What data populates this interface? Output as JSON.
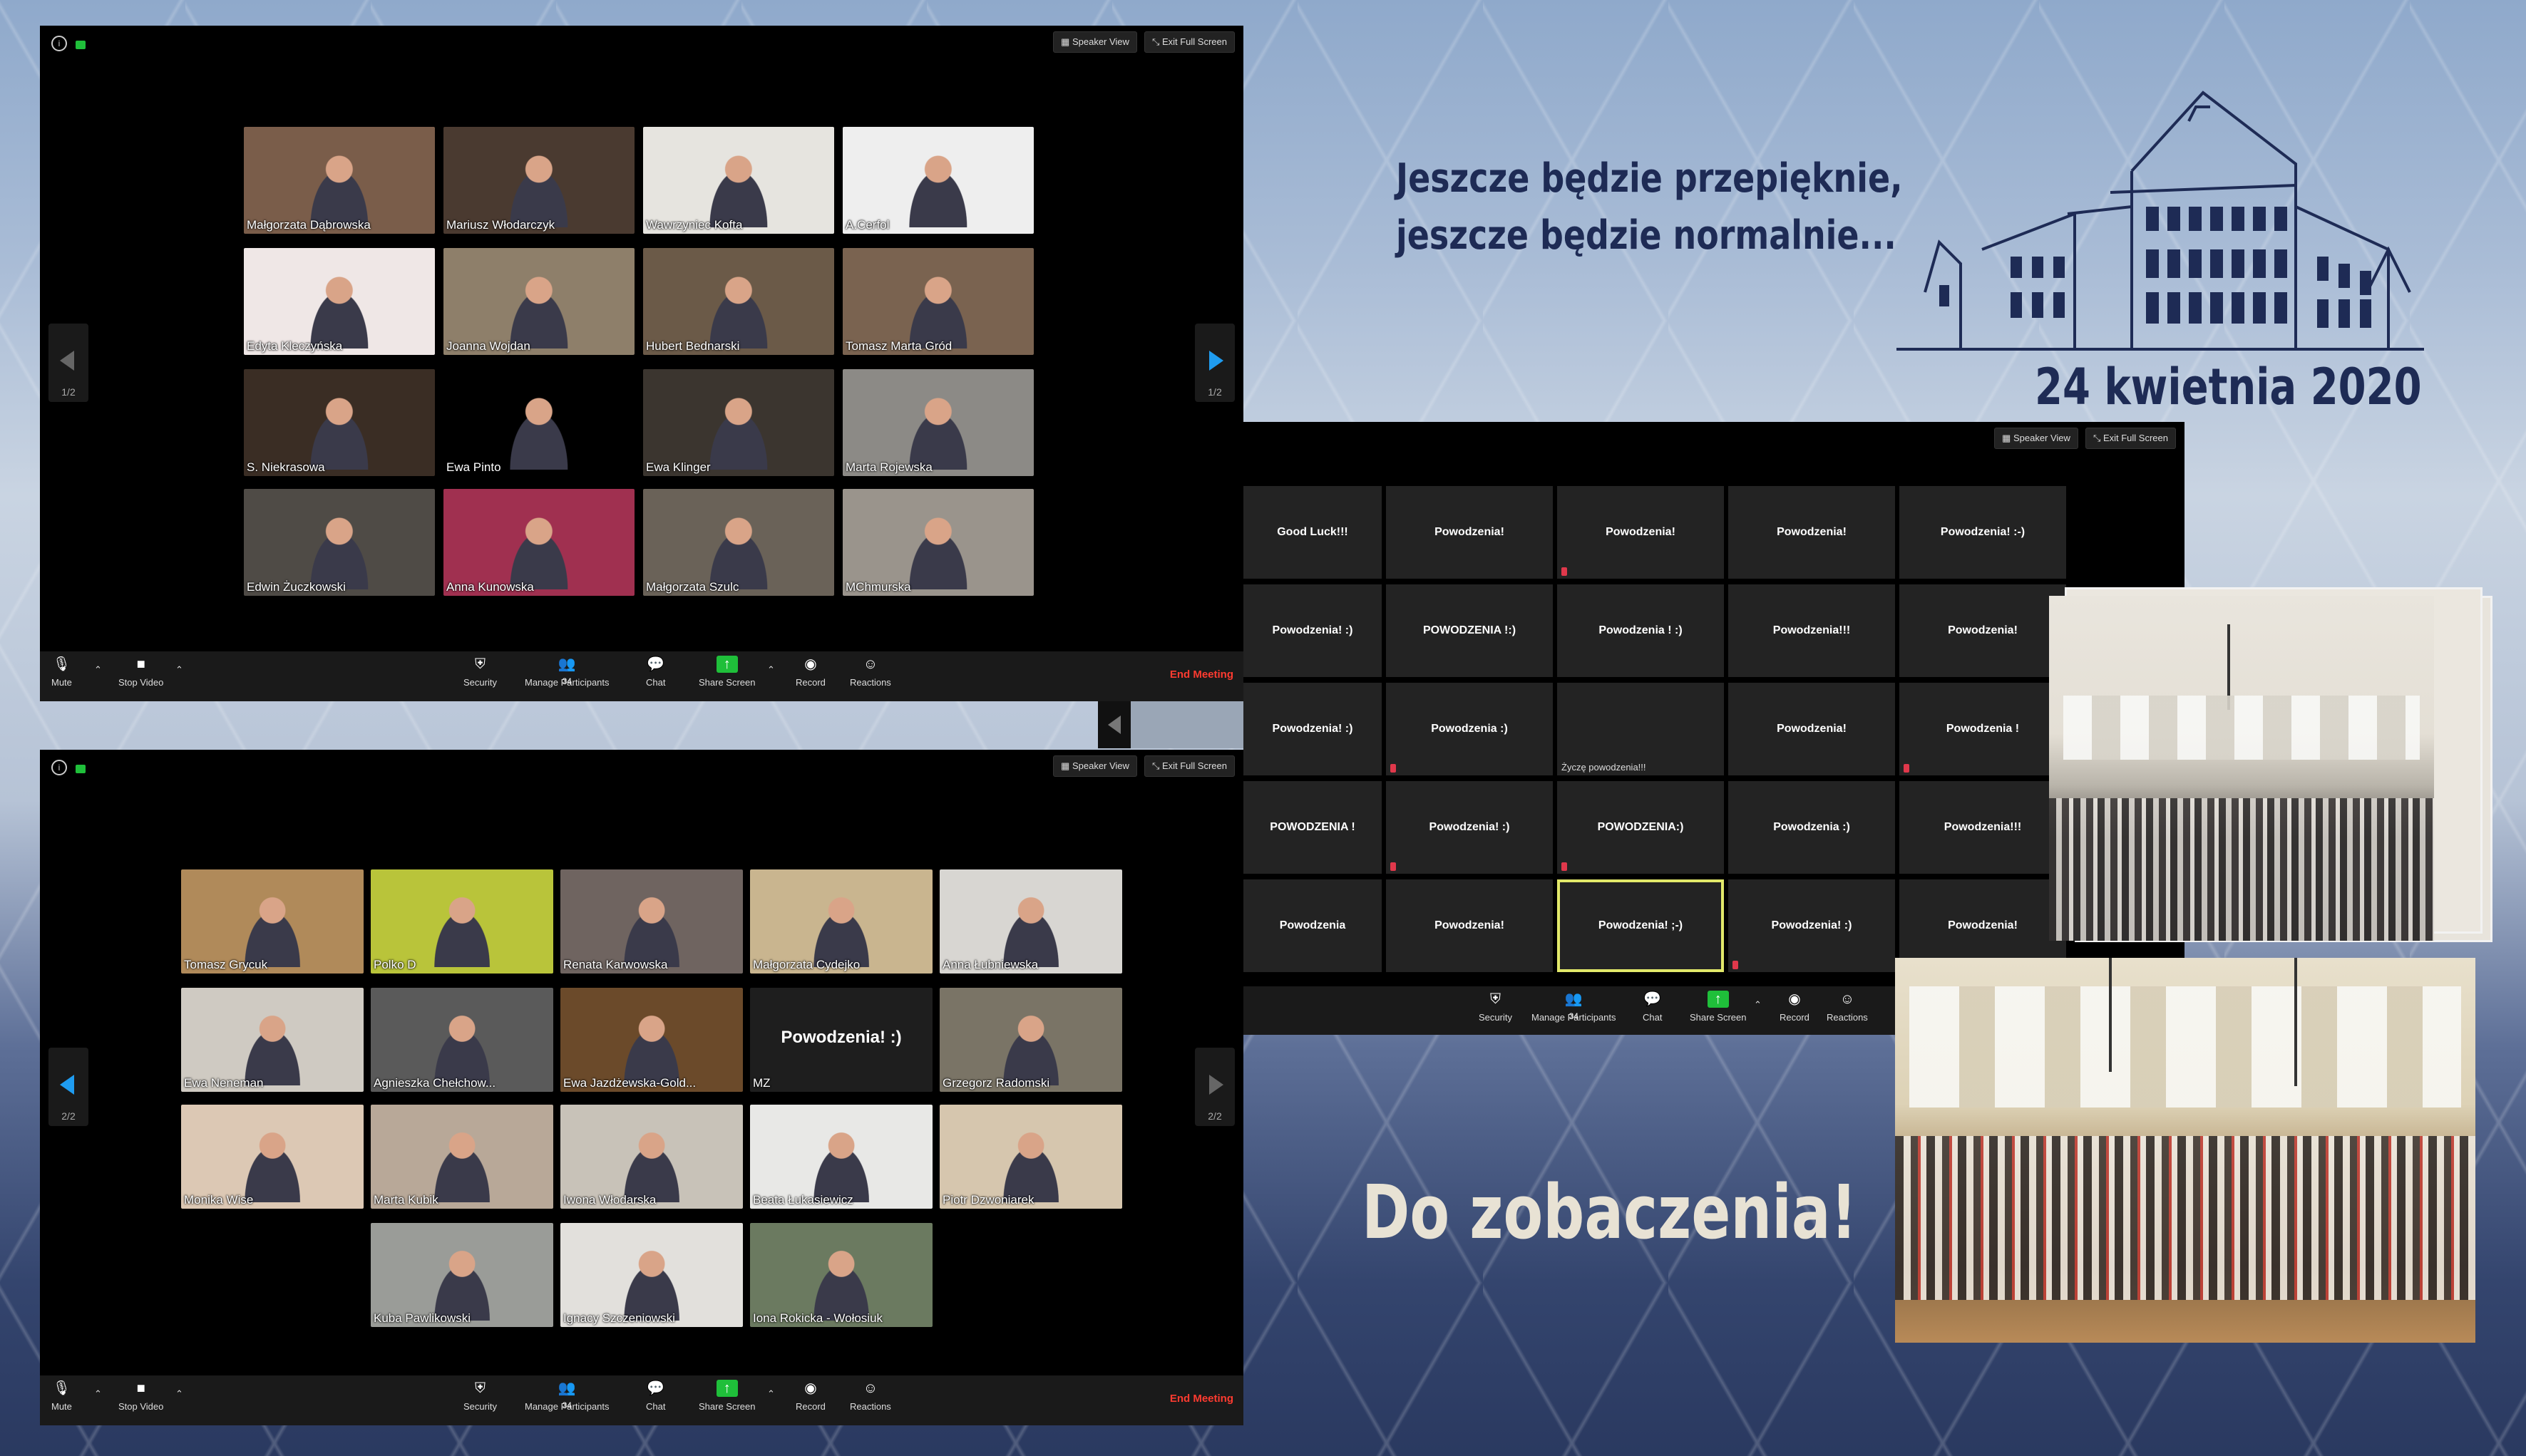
{
  "slogan": {
    "line1": "Jeszcze będzie przepięknie,",
    "line2": "jeszcze będzie normalnie...",
    "date": "24 kwietnia 2020 r.",
    "farewell": "Do zobaczenia!"
  },
  "toolbar": {
    "speaker_view": "Speaker View",
    "exit_fullscreen": "Exit Full Screen",
    "mute": "Mute",
    "stop_video": "Stop Video",
    "security": "Security",
    "manage_participants": "Manage Participants",
    "participant_count": "34",
    "chat": "Chat",
    "share_screen": "Share Screen",
    "record": "Record",
    "reactions": "Reactions",
    "end_meeting": "End Meeting"
  },
  "window1": {
    "page": "1/2",
    "tiles": [
      {
        "name": "Małgorzata Dąbrowska",
        "bg": "#7a5d4a"
      },
      {
        "name": "Mariusz Włodarczyk",
        "bg": "#4a3a30"
      },
      {
        "name": "Wawrzyniec Kofta",
        "bg": "#e6e4df"
      },
      {
        "name": "A.Cerfol",
        "bg": "#eeeeee"
      },
      {
        "name": "Edyta Kleczyńska",
        "bg": "#efe7e6"
      },
      {
        "name": "Joanna Wojdan",
        "bg": "#8e7f6a"
      },
      {
        "name": "Hubert Bednarski",
        "bg": "#6b5a48"
      },
      {
        "name": "Tomasz Marta Gród",
        "bg": "#7a6350"
      },
      {
        "name": "S. Niekrasowa",
        "bg": "#3a2d24"
      },
      {
        "name": "Ewa Pinto",
        "bg": "#000000"
      },
      {
        "name": "Ewa Klinger",
        "bg": "#3b352f"
      },
      {
        "name": "Marta Rojewska",
        "bg": "#8c8a86"
      },
      {
        "name": "Edwin Żuczkowski",
        "bg": "#4f4b46"
      },
      {
        "name": "Anna Kunowska",
        "bg": "#a03050"
      },
      {
        "name": "Małgorzata Szulc",
        "bg": "#6a6258"
      },
      {
        "name": "MChmurska",
        "bg": "#9a948c"
      }
    ]
  },
  "window2": {
    "page": "2/2",
    "tiles": [
      {
        "name": "Tomasz Grycuk",
        "bg": "#b08a5a"
      },
      {
        "name": "Polko D",
        "bg": "#b9c43a"
      },
      {
        "name": "Renata Karwowska",
        "bg": "#6f6460"
      },
      {
        "name": "Małgorzata Cydejko",
        "bg": "#c9b58f"
      },
      {
        "name": "Anna Łubniewska",
        "bg": "#d8d6d2"
      },
      {
        "name": "Ewa Neneman",
        "bg": "#cfcac2"
      },
      {
        "name": "Agnieszka Chełchow...",
        "bg": "#5a5a5a"
      },
      {
        "name": "Ewa Jazdżewska-Gold...",
        "bg": "#6b4a2a"
      },
      {
        "name": "MZ",
        "bg": "#1e1e1e",
        "text": "Powodzenia! :)"
      },
      {
        "name": "Grzegorz Radomski",
        "bg": "#7a7466"
      },
      {
        "name": "Monika Wise",
        "bg": "#dcc8b4"
      },
      {
        "name": "Marta Kubik",
        "bg": "#b8a898"
      },
      {
        "name": "Iwona Włodarska",
        "bg": "#c8c2b8"
      },
      {
        "name": "Beata Łukasiewicz",
        "bg": "#e8e8e6"
      },
      {
        "name": "Piotr Dzwoniarek",
        "bg": "#d6c6ae"
      },
      {
        "name": "Kuba Pawlikowski",
        "bg": "#9a9c98"
      },
      {
        "name": "Ignacy Szczeniowski",
        "bg": "#e2e0dc"
      },
      {
        "name": "Iona Rokicka - Wołosiuk",
        "bg": "#6b7a60"
      }
    ]
  },
  "window3": {
    "cells": [
      {
        "text": "Good Luck!!!"
      },
      {
        "text": "Powodzenia!"
      },
      {
        "text": "Powodzenia!"
      },
      {
        "text": "Powodzenia!"
      },
      {
        "text": "Powodzenia! :-)"
      },
      {
        "text": "Powodzenia! :)"
      },
      {
        "text": "POWODZENIA !:)"
      },
      {
        "text": "Powodzenia ! :)"
      },
      {
        "text": "Powodzenia!!!"
      },
      {
        "text": "Powodzenia!"
      },
      {
        "text": "Powodzenia! :)"
      },
      {
        "text": "Powodzenia :)"
      },
      {
        "text": "",
        "caption": "Życzę powodzenia!!!"
      },
      {
        "text": "Powodzenia!"
      },
      {
        "text": "Powodzenia !"
      },
      {
        "text": "POWODZENIA !"
      },
      {
        "text": "Powodzenia! :)"
      },
      {
        "text": "POWODZENIA:)"
      },
      {
        "text": "Powodzenia :)"
      },
      {
        "text": "Powodzenia!!!"
      },
      {
        "text": "Powodzenia"
      },
      {
        "text": "Powodzenia!"
      },
      {
        "text": "Powodzenia! ;-)"
      },
      {
        "text": "Powodzenia! :)"
      },
      {
        "text": "Powodzenia!"
      }
    ]
  },
  "colors": {
    "accent": "#1e2b55",
    "end_meeting": "#ff3b30",
    "share_green": "#1fbf3a",
    "active_speaker": "#e2e86a"
  }
}
